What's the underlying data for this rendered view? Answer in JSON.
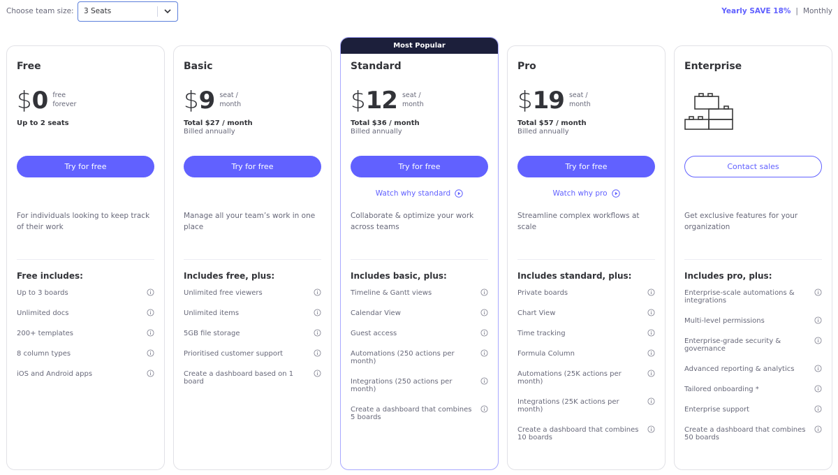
{
  "header": {
    "team_size_label": "Choose team size:",
    "team_size_value": "3 Seats",
    "billing_yearly": "Yearly SAVE 18%",
    "billing_separator": "|",
    "billing_monthly": "Monthly"
  },
  "colors": {
    "accent": "#6161ff",
    "banner": "#1c1f3b",
    "text_primary": "#323338",
    "text_secondary": "#676879"
  },
  "plans": [
    {
      "name": "Free",
      "currency": "$",
      "price": "0",
      "unit_line1": "free",
      "unit_line2": "forever",
      "total": "Up to 2 seats",
      "billed": "",
      "cta": "Try for free",
      "watch": "",
      "description": "For individuals looking to keep track of their work",
      "includes_title": "Free includes:",
      "features": [
        "Up to 3 boards",
        "Unlimited docs",
        "200+ templates",
        "8 column types",
        "iOS and Android apps"
      ]
    },
    {
      "name": "Basic",
      "currency": "$",
      "price": "9",
      "unit_line1": "seat /",
      "unit_line2": "month",
      "total": "Total $27 / month",
      "billed": "Billed annually",
      "cta": "Try for free",
      "watch": "",
      "description": "Manage all your team’s work in one place",
      "includes_title": "Includes free, plus:",
      "features": [
        "Unlimited free viewers",
        "Unlimited items",
        "5GB file storage",
        "Prioritised customer support",
        "Create a dashboard based on 1 board"
      ]
    },
    {
      "name": "Standard",
      "badge": "Most Popular",
      "currency": "$",
      "price": "12",
      "unit_line1": "seat /",
      "unit_line2": "month",
      "total": "Total $36 / month",
      "billed": "Billed annually",
      "cta": "Try for free",
      "watch": "Watch why standard",
      "description": "Collaborate & optimize your work across teams",
      "includes_title": "Includes basic, plus:",
      "features": [
        "Timeline & Gantt views",
        "Calendar View",
        "Guest access",
        "Automations (250 actions per month)",
        "Integrations (250 actions per month)",
        "Create a dashboard that combines 5 boards"
      ]
    },
    {
      "name": "Pro",
      "currency": "$",
      "price": "19",
      "unit_line1": "seat /",
      "unit_line2": "month",
      "total": "Total $57 / month",
      "billed": "Billed annually",
      "cta": "Try for free",
      "watch": "Watch why pro",
      "description": "Streamline complex workflows at scale",
      "includes_title": "Includes standard, plus:",
      "features": [
        "Private boards",
        "Chart View",
        "Time tracking",
        "Formula Column",
        "Automations (25K actions per month)",
        "Integrations (25K actions per month)",
        "Create a dashboard that combines 10 boards"
      ]
    },
    {
      "name": "Enterprise",
      "icon": "building-blocks-icon",
      "cta": "Contact sales",
      "description": "Get exclusive features for your organization",
      "includes_title": "Includes pro, plus:",
      "features": [
        "Enterprise-scale automations & integrations",
        "Multi-level permissions",
        "Enterprise-grade security & governance",
        "Advanced reporting & analytics",
        "Tailored onboarding *",
        "Enterprise support",
        "Create a dashboard that combines 50 boards"
      ]
    }
  ]
}
